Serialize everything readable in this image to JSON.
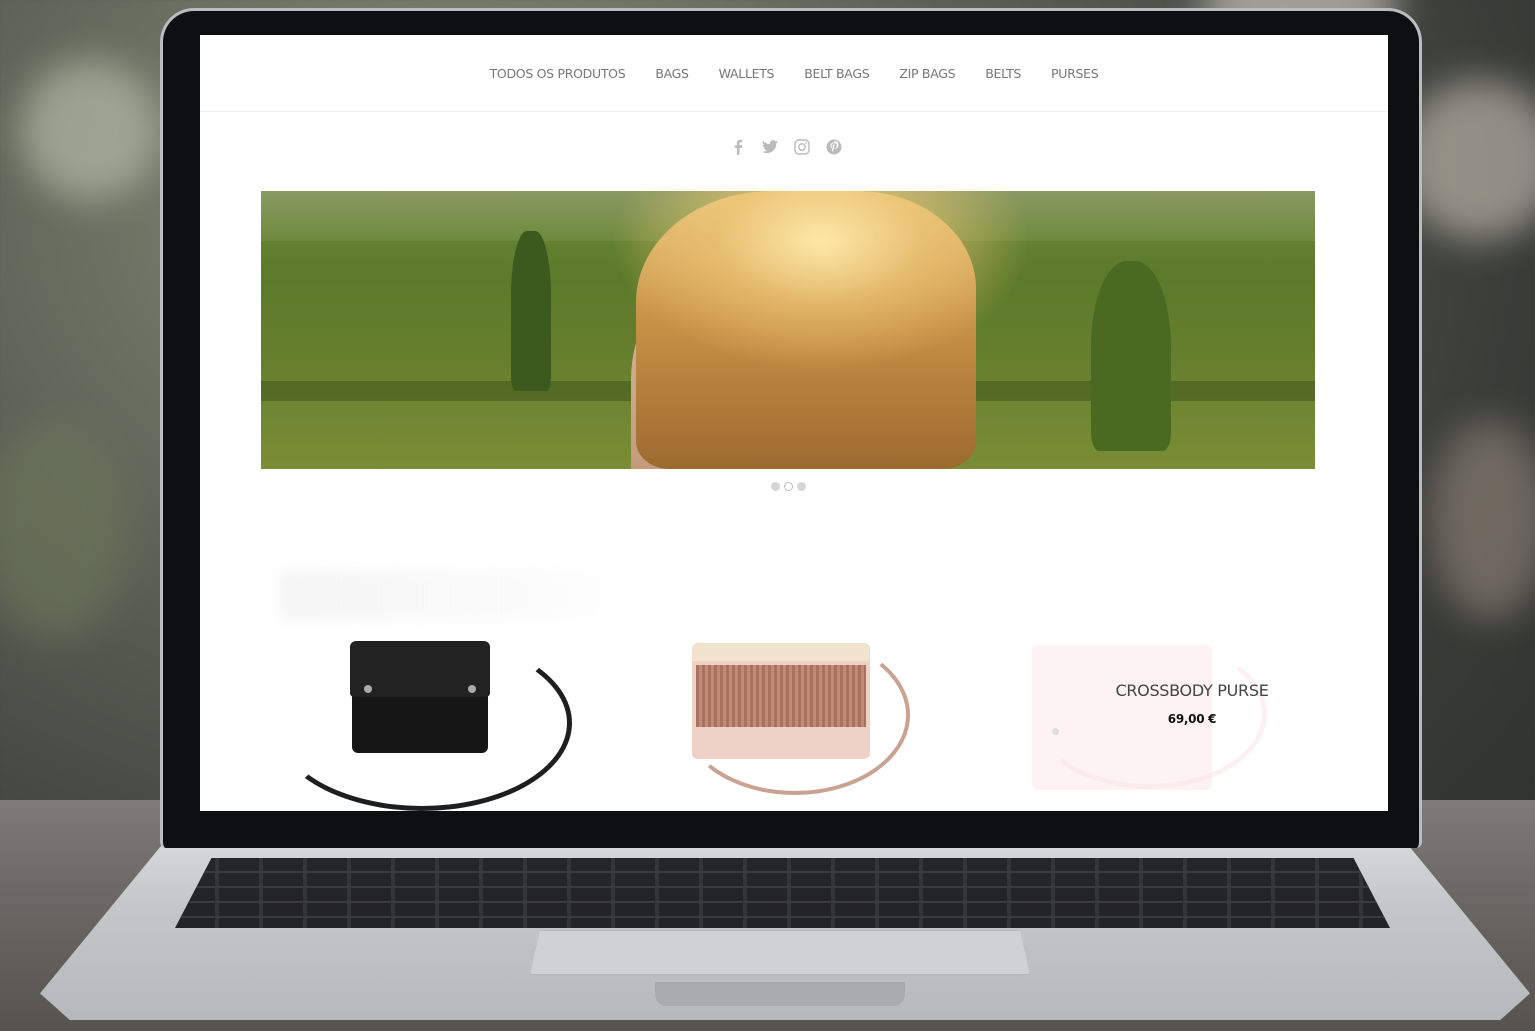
{
  "nav": {
    "items": [
      {
        "label": "TODOS OS PRODUTOS"
      },
      {
        "label": "BAGS"
      },
      {
        "label": "WALLETS"
      },
      {
        "label": "BELT BAGS"
      },
      {
        "label": "ZIP BAGS"
      },
      {
        "label": "BELTS"
      },
      {
        "label": "PURSES"
      }
    ]
  },
  "social": {
    "icons": [
      "facebook-icon",
      "twitter-icon",
      "instagram-icon",
      "pinterest-icon"
    ]
  },
  "slider": {
    "dot_count": 3,
    "active_index": 1
  },
  "products": [
    {
      "title": "",
      "price": ""
    },
    {
      "title": "",
      "price": ""
    },
    {
      "title": "CROSSBODY PURSE",
      "price": "69,00 €"
    }
  ],
  "colors": {
    "nav_text": "#777777",
    "social_icon": "#bbbbbb",
    "price_text": "#111111"
  }
}
